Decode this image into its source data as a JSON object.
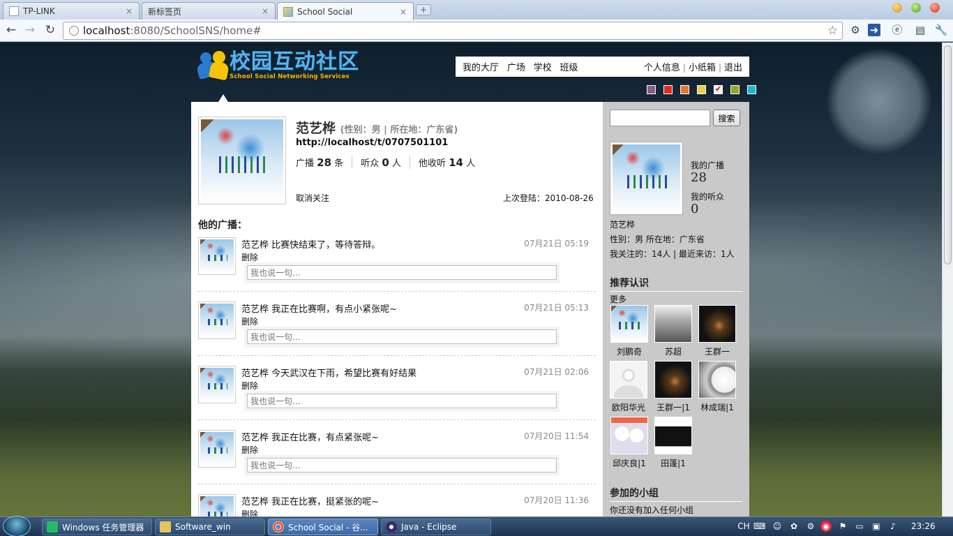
{
  "browser": {
    "tabs": [
      {
        "label": "TP-LINK"
      },
      {
        "label": "新标签页"
      },
      {
        "label": "School Social"
      }
    ],
    "tab_close": "×",
    "new_tab": "+",
    "back": "←",
    "forward": "→",
    "reload": "↻",
    "url_host": "localhost",
    "url_rest": ":8080/SchoolSNS/home#",
    "bookmark_star": "☆",
    "wrench": "🔧"
  },
  "site": {
    "logo_title": "校园互动社区",
    "logo_sub": "School Social Networking Services",
    "nav_left": [
      "我的大厅",
      "广场",
      "学校",
      "班级"
    ],
    "nav_right": [
      "个人信息",
      "小纸箱",
      "退出"
    ],
    "nav_sep": "|",
    "swatches": [
      "#8a5c8e",
      "#e02b20",
      "#e27830",
      "#e8cf46",
      "#f0f0f0",
      "#93a824",
      "#1fb6c8"
    ]
  },
  "profile": {
    "name": "范艺桦",
    "meta": "(性别：男 | 所在地：广东省)",
    "link": "http://localhost/t/0707501101",
    "broadcast_label": "广播",
    "broadcast_count": "28",
    "broadcast_unit": "条",
    "followers_label": "听众",
    "followers_count": "0",
    "followers_unit": "人",
    "following_label": "他收听",
    "following_count": "14",
    "following_unit": "人",
    "unfollow": "取消关注",
    "last_login_label": "上次登陆：",
    "last_login": "2010-08-26"
  },
  "feed": {
    "title": "他的广播：",
    "reply_placeholder": "我也说一句...",
    "delete_label": "删除",
    "posts": [
      {
        "text": "范艺桦 比赛快结束了，等待答辩。",
        "time": "07月21日 05:19"
      },
      {
        "text": "范艺桦 我正在比赛啊，有点小紧张呢~",
        "time": "07月21日 05:13"
      },
      {
        "text": "范艺桦 今天武汉在下雨，希望比赛有好结果",
        "time": "07月21日 02:06"
      },
      {
        "text": "范艺桦 我正在比赛，有点紧张呢~",
        "time": "07月20日 11:54"
      },
      {
        "text": "范艺桦 我正在比赛，挺紧张的呢~",
        "time": "07月20日 11:36"
      }
    ]
  },
  "sidebar": {
    "search_button": "搜索",
    "my_broadcast_label": "我的广播",
    "my_broadcast_value": "28",
    "my_followers_label": "我的听众",
    "my_followers_value": "0",
    "name": "范艺桦",
    "info": "性别：男 所在地：广东省",
    "follow_info": "我关注的：14人 | 最近来访：1人",
    "recommend_title": "推荐认识",
    "more": "更多",
    "friends": [
      {
        "name": "刘鹏奇"
      },
      {
        "name": "苏超"
      },
      {
        "name": "王群一"
      },
      {
        "name": "欧阳华光"
      },
      {
        "name": "王群一|1"
      },
      {
        "name": "林成瑞|1"
      },
      {
        "name": "邱庆良|1"
      },
      {
        "name": "田蓬|1"
      }
    ],
    "groups_title": "参加的小组",
    "groups_empty": "你还没有加入任何小组"
  },
  "taskbar": {
    "tasks": [
      {
        "label": "Windows 任务管理器"
      },
      {
        "label": "Software_win"
      },
      {
        "label": "School Social - 谷..."
      },
      {
        "label": "Java  -  Eclipse"
      }
    ],
    "ime": "CH",
    "clock": "23:26"
  }
}
